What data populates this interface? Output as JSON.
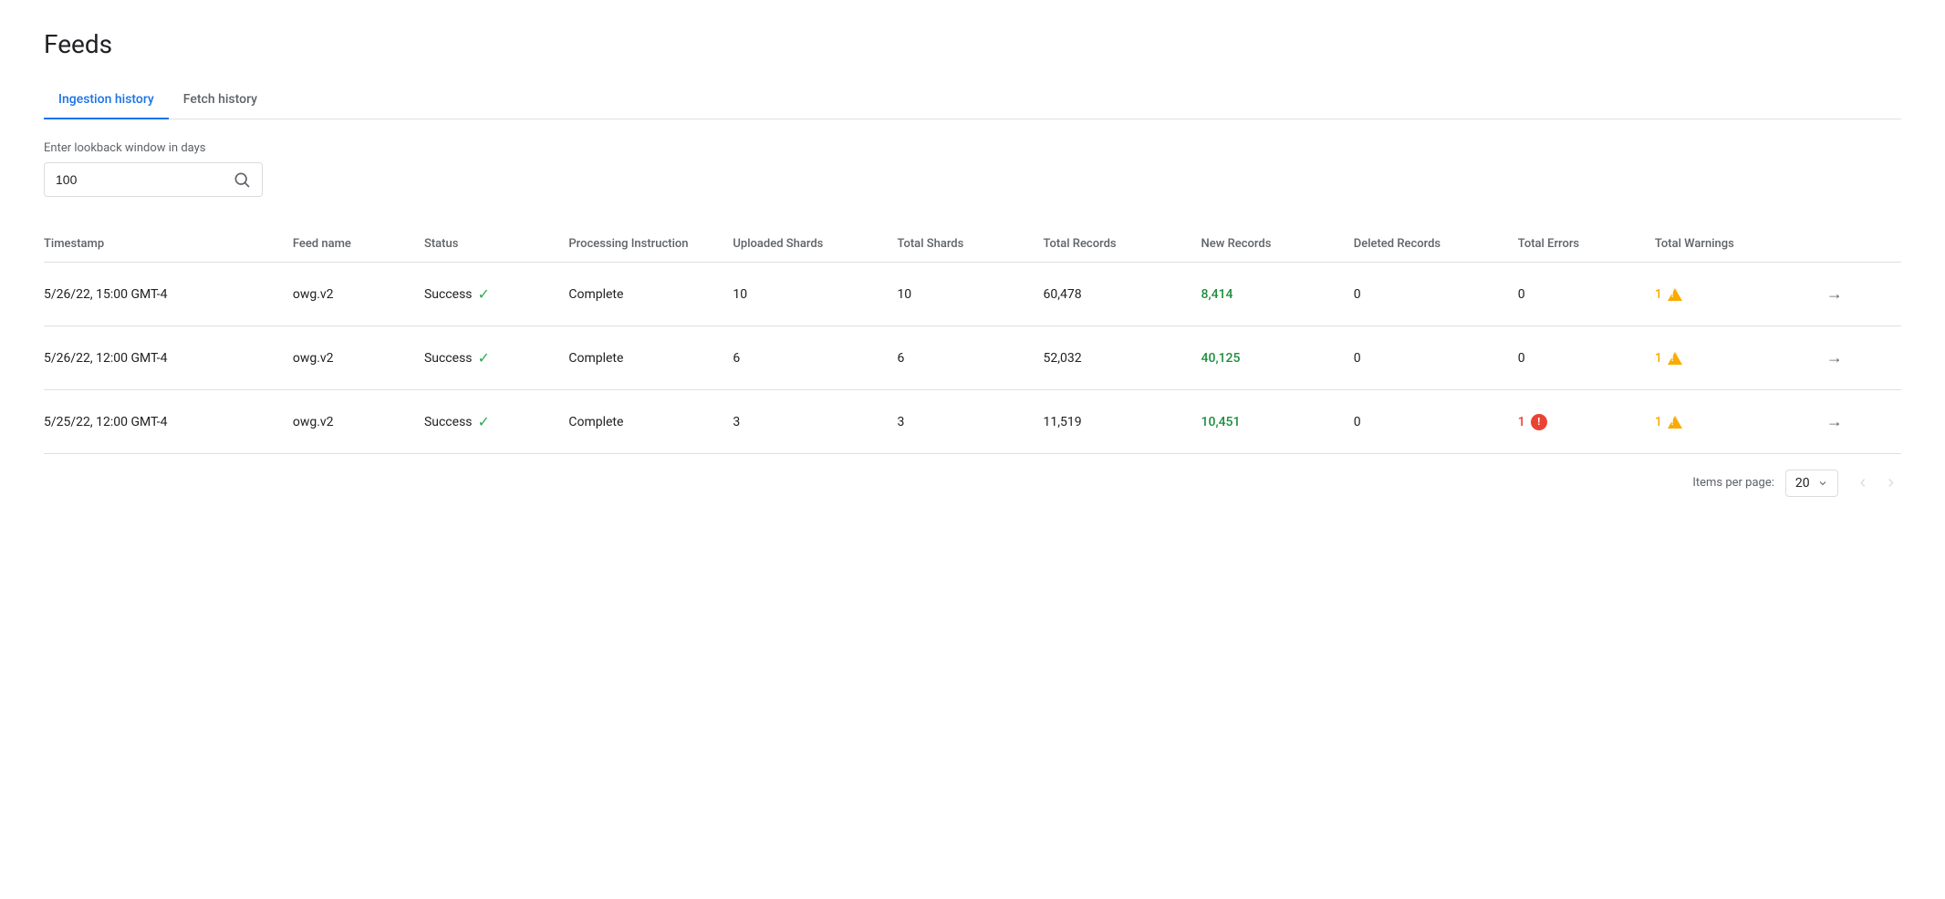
{
  "page": {
    "title": "Feeds"
  },
  "tabs": [
    {
      "id": "ingestion-history",
      "label": "Ingestion history",
      "active": true
    },
    {
      "id": "fetch-history",
      "label": "Fetch history",
      "active": false
    }
  ],
  "search": {
    "label": "Enter lookback window in days",
    "value": "100",
    "placeholder": ""
  },
  "table": {
    "columns": [
      {
        "id": "timestamp",
        "label": "Timestamp"
      },
      {
        "id": "feed-name",
        "label": "Feed name"
      },
      {
        "id": "status",
        "label": "Status"
      },
      {
        "id": "processing-instruction",
        "label": "Processing Instruction"
      },
      {
        "id": "uploaded-shards",
        "label": "Uploaded Shards"
      },
      {
        "id": "total-shards",
        "label": "Total Shards"
      },
      {
        "id": "total-records",
        "label": "Total Records"
      },
      {
        "id": "new-records",
        "label": "New Records"
      },
      {
        "id": "deleted-records",
        "label": "Deleted Records"
      },
      {
        "id": "total-errors",
        "label": "Total Errors"
      },
      {
        "id": "total-warnings",
        "label": "Total Warnings"
      }
    ],
    "rows": [
      {
        "timestamp": "5/26/22, 15:00 GMT-4",
        "feedName": "owg.v2",
        "status": "Success",
        "processingInstruction": "Complete",
        "uploadedShards": "10",
        "totalShards": "10",
        "totalRecords": "60,478",
        "newRecords": "8,414",
        "deletedRecords": "0",
        "totalErrors": "0",
        "totalWarnings": "1",
        "hasError": false,
        "hasWarning": true
      },
      {
        "timestamp": "5/26/22, 12:00 GMT-4",
        "feedName": "owg.v2",
        "status": "Success",
        "processingInstruction": "Complete",
        "uploadedShards": "6",
        "totalShards": "6",
        "totalRecords": "52,032",
        "newRecords": "40,125",
        "deletedRecords": "0",
        "totalErrors": "0",
        "totalWarnings": "1",
        "hasError": false,
        "hasWarning": true
      },
      {
        "timestamp": "5/25/22, 12:00 GMT-4",
        "feedName": "owg.v2",
        "status": "Success",
        "processingInstruction": "Complete",
        "uploadedShards": "3",
        "totalShards": "3",
        "totalRecords": "11,519",
        "newRecords": "10,451",
        "deletedRecords": "0",
        "totalErrors": "1",
        "totalWarnings": "1",
        "hasError": true,
        "hasWarning": true
      }
    ]
  },
  "pagination": {
    "items_per_page_label": "Items per page:",
    "items_per_page_value": "20"
  }
}
